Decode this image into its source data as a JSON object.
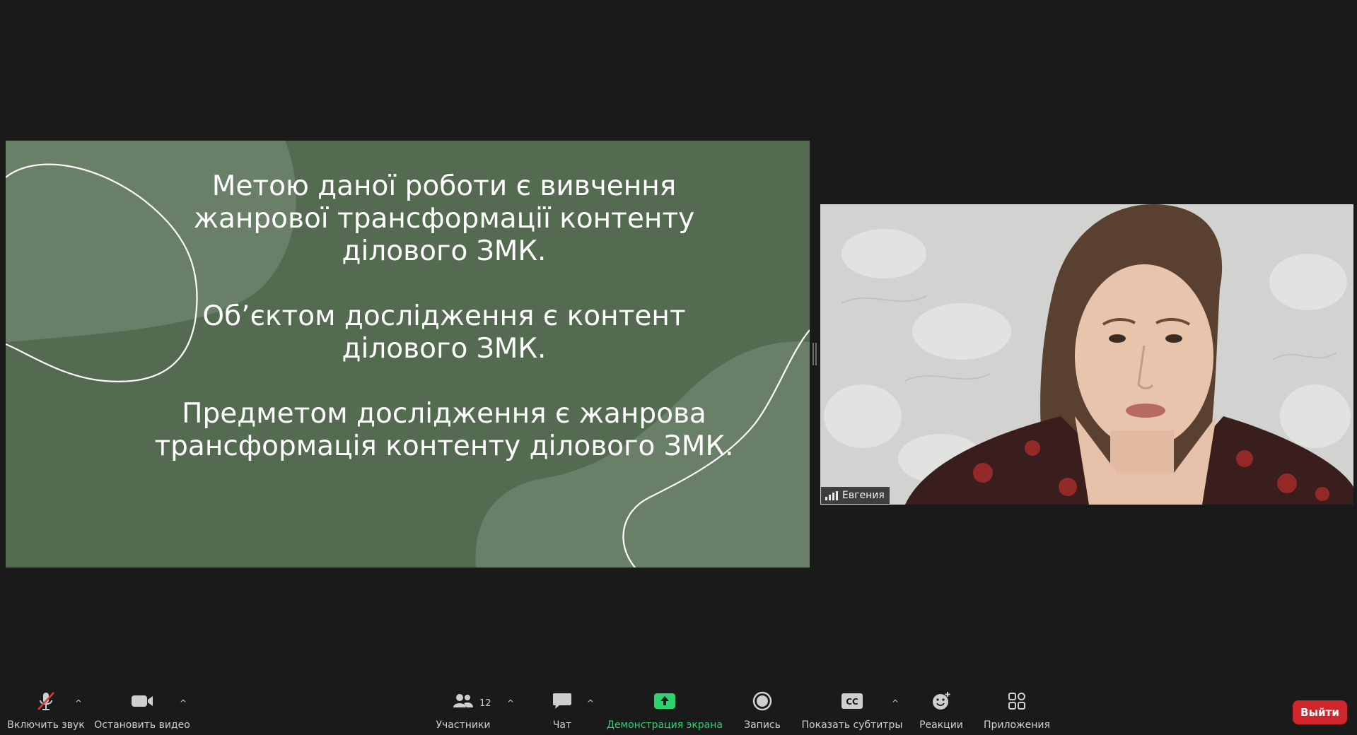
{
  "shared_screen": {
    "paragraphs": [
      "Метою даної роботи є вивчення жанрової трансформації контенту ділового ЗМК.",
      "Об’єктом дослідження є контент ділового ЗМК.",
      "Предметом дослідження є жанрова трансформація контенту ділового ЗМК."
    ]
  },
  "participant_video": {
    "name": "Евгения"
  },
  "toolbar": {
    "audio_label": "Включить звук",
    "video_label": "Остановить видео",
    "participants_label": "Участники",
    "participants_count": "12",
    "chat_label": "Чат",
    "share_label": "Демонстрация экрана",
    "record_label": "Запись",
    "captions_label": "Показать субтитры",
    "captions_icon_text": "CC",
    "reactions_label": "Реакции",
    "apps_label": "Приложения",
    "leave_label": "Выйти"
  },
  "colors": {
    "slide_bg": "#546a51",
    "slide_shape": "#6a7f67",
    "share_green": "#2dd36f",
    "leave_red": "#d0262b"
  }
}
